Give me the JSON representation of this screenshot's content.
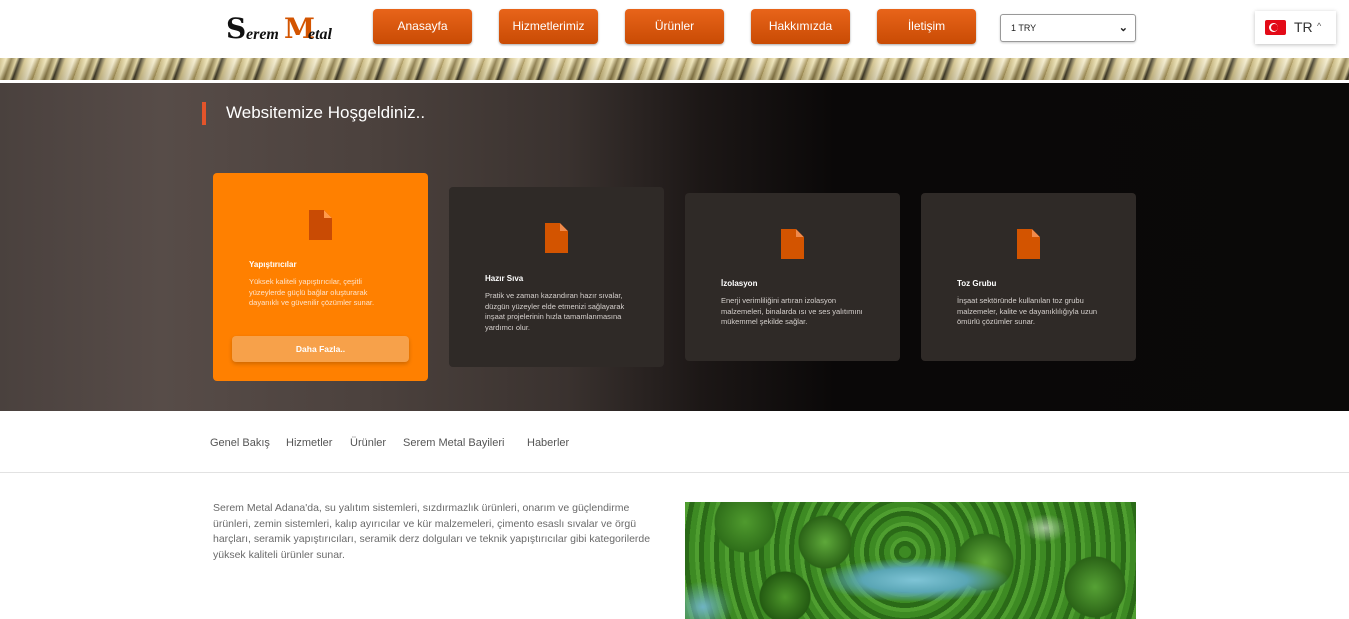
{
  "header": {
    "logo": {
      "word1": "Serem",
      "word2": "Metal"
    },
    "nav": [
      "Anasayfa",
      "Hizmetlerimiz",
      "Ürünler",
      "Hakkımızda",
      "İletişim"
    ],
    "currency": {
      "selected": "1 TRY",
      "arrow_icon": "chevron-down-icon"
    },
    "language": {
      "code": "TR",
      "flag_icon": "turkey-flag-icon",
      "caret_icon": "chevron-up-icon"
    }
  },
  "hero": {
    "title": "Websitemize Hoşgeldiniz..",
    "cards": [
      {
        "title": "Yapıştırıcılar",
        "text": "Yüksek kaliteli yapıştırıcılar, çeşitli yüzeylerde güçlü bağlar oluşturarak dayanıklı ve güvenilir çözümler sunar.",
        "button": "Daha Fazla..",
        "icon": "document-icon"
      },
      {
        "title": "Hazır Sıva",
        "text": "Pratik ve zaman kazandıran hazır sıvalar, düzgün yüzeyler elde etmenizi sağlayarak inşaat projelerinin hızla tamamlanmasına yardımcı olur.",
        "icon": "document-icon"
      },
      {
        "title": "İzolasyon",
        "text": "Enerji verimliliğini artıran izolasyon malzemeleri, binalarda ısı ve ses yalıtımını mükemmel şekilde sağlar.",
        "icon": "document-icon"
      },
      {
        "title": "Toz Grubu",
        "text": "İnşaat sektöründe kullanılan toz grubu malzemeler, kalite ve dayanıklılığıyla uzun ömürlü çözümler sunar.",
        "icon": "document-icon"
      }
    ]
  },
  "tabs": [
    "Genel Bakış",
    "Hizmetler",
    "Ürünler",
    "Serem Metal Bayileri",
    "Haberler"
  ],
  "about": {
    "text": "Serem Metal Adana'da, su yalıtım sistemleri, sızdırmazlık ürünleri, onarım ve güçlendirme ürünleri, zemin sistemleri, kalıp ayırıcılar ve kür malzemeleri, çimento esaslı sıvalar ve örgü harçları, seramik yapıştırıcıları, seramik derz dolguları ve teknik yapıştırıcılar gibi kategorilerde yüksek kaliteli ürünler sunar."
  },
  "colors": {
    "accent": "#d35400",
    "active_card": "#ff8000",
    "hero_dark": "#0a0908"
  }
}
